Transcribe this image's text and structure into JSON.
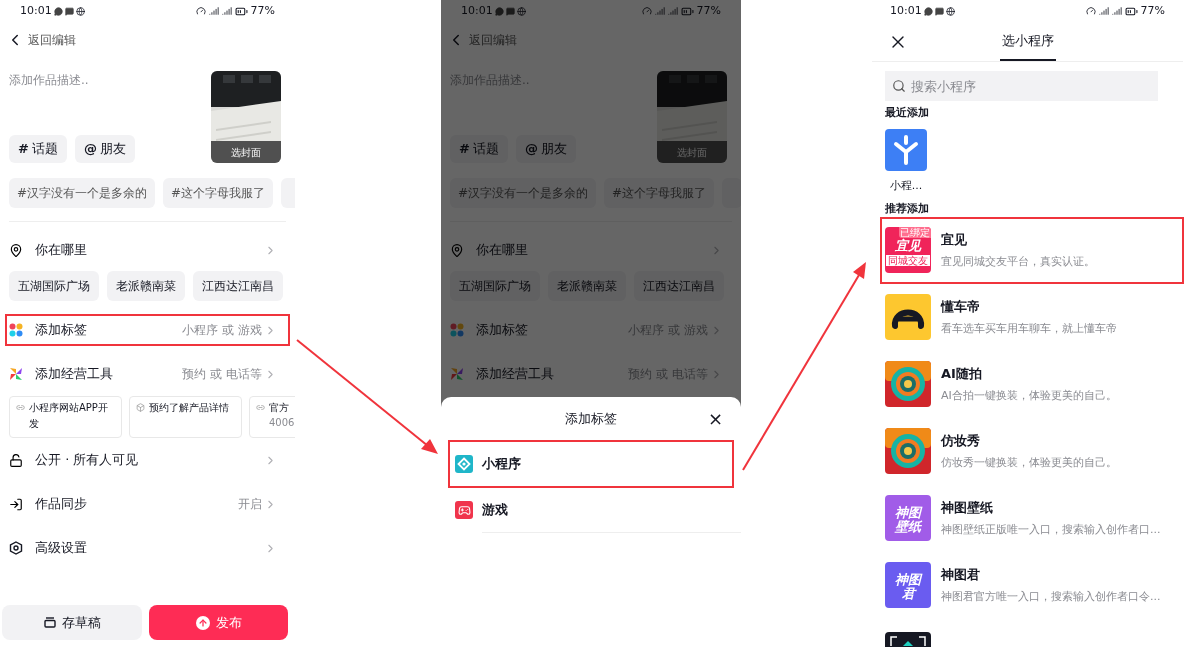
{
  "publish_screen": {
    "status_bar": {
      "time": "10:01",
      "battery": "77%"
    },
    "back_label": "返回编辑",
    "description_placeholder": "添加作品描述..",
    "cover_label": "选封面",
    "quick_chips": [
      {
        "symbol": "#",
        "label": "话题"
      },
      {
        "symbol": "@",
        "label": "朋友"
      }
    ],
    "hashtags": [
      "#汉字没有一个是多余的",
      "#这个字母我服了"
    ],
    "settings": [
      {
        "kind": "location",
        "label": "你在哪里",
        "highlighted": false
      },
      {
        "kind": "chips",
        "chips": [
          "五湖国际广场",
          "老派赣南菜",
          "江西达江南昌"
        ]
      },
      {
        "kind": "tag",
        "label": "添加标签",
        "value": "小程序 或 游戏",
        "highlighted": true
      },
      {
        "kind": "tools",
        "label": "添加经营工具",
        "value": "预约 或 电话等",
        "highlighted": false
      },
      {
        "kind": "cards",
        "cards": [
          {
            "kind": "link",
            "title": "小程序网站APP开发"
          },
          {
            "kind": "box",
            "title": "预约了解产品详情"
          },
          {
            "kind": "link",
            "title": "官方",
            "subtitle": "4006"
          }
        ]
      },
      {
        "kind": "privacy",
        "label": "公开 · 所有人可见",
        "highlighted": false
      },
      {
        "kind": "sync",
        "label": "作品同步",
        "value": "开启",
        "highlighted": false
      },
      {
        "kind": "advanced",
        "label": "高级设置",
        "highlighted": false
      }
    ],
    "draft_button": "存草稿",
    "publish_button": "发布"
  },
  "sheet_screen": {
    "background": {
      "status_bar": {
        "time": "10:01",
        "battery": "77%"
      },
      "back_label": "返回编辑",
      "description_placeholder": "添加作品描述..",
      "cover_label": "选封面",
      "quick_chips": [
        {
          "symbol": "#",
          "label": "话题"
        },
        {
          "symbol": "@",
          "label": "朋友"
        }
      ],
      "hashtags": [
        "#汉字没有一个是多余的",
        "#这个字母我服了"
      ],
      "settings": [
        {
          "kind": "location",
          "label": "你在哪里",
          "highlighted": false
        },
        {
          "kind": "chips",
          "chips": [
            "五湖国际广场",
            "老派赣南菜",
            "江西达江南昌"
          ]
        },
        {
          "kind": "tag",
          "label": "添加标签",
          "value": "小程序 或 游戏",
          "highlighted": false
        },
        {
          "kind": "tools",
          "label": "添加经营工具",
          "value": "预约 或 电话等",
          "highlighted": false
        }
      ]
    },
    "sheet": {
      "title": "添加标签",
      "close": "×",
      "items": [
        {
          "kind": "miniprogram",
          "label": "小程序",
          "highlighted": true
        },
        {
          "kind": "game",
          "label": "游戏",
          "highlighted": false
        }
      ]
    }
  },
  "picker_screen": {
    "status_bar": {
      "time": "10:01",
      "battery": "77%"
    },
    "title": "选小程序",
    "search": {
      "placeholder": "搜索小程序"
    },
    "recent_label": "最近添加",
    "recent": [
      {
        "name": "小程...",
        "kind": "asterisk"
      }
    ],
    "recommended_label": "推荐添加",
    "apps": [
      {
        "name": "宜见",
        "description": "宜见同城交友平台，真实认证。",
        "kind": "text",
        "color": "#f0245a",
        "icon_text": "宜见",
        "icon_caption": "同城交友",
        "badge": "已绑定",
        "highlighted": true
      },
      {
        "name": "懂车帝",
        "description": "看车选车买车用车聊车，就上懂车帝",
        "kind": "arc",
        "highlighted": false
      },
      {
        "name": "AI随拍",
        "description": "AI合拍一键换装，体验更美的自己。",
        "kind": "swirl",
        "highlighted": false
      },
      {
        "name": "仿妆秀",
        "description": "仿妆秀一键换装，体验更美的自己。",
        "kind": "swirl",
        "highlighted": false
      },
      {
        "name": "神图壁纸",
        "description": "神图壁纸正版唯一入口，搜索输入创作者口...",
        "kind": "text",
        "color": "#a15ce8",
        "icon_text": "神图壁纸",
        "highlighted": false
      },
      {
        "name": "神图君",
        "description": "神图君官方唯一入口，搜索输入创作者口令...",
        "kind": "text",
        "color": "#6a5cf0",
        "icon_text": "神图君",
        "highlighted": false
      },
      {
        "kind": "dark",
        "highlighted": false
      }
    ]
  }
}
